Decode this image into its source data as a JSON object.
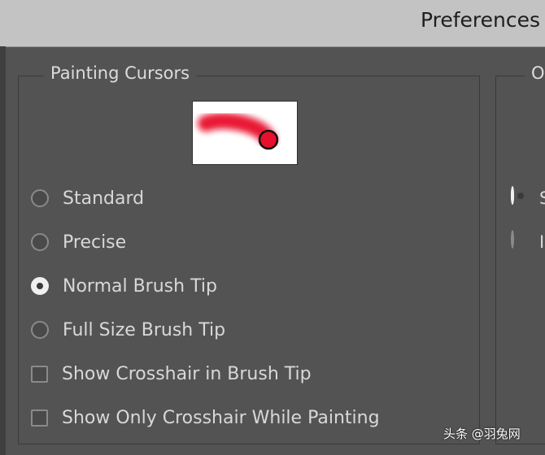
{
  "window": {
    "title": "Preferences"
  },
  "painting_cursors": {
    "legend": "Painting Cursors",
    "options": [
      {
        "label": "Standard",
        "type": "radio",
        "checked": false
      },
      {
        "label": "Precise",
        "type": "radio",
        "checked": false
      },
      {
        "label": "Normal Brush Tip",
        "type": "radio",
        "checked": true
      },
      {
        "label": "Full Size Brush Tip",
        "type": "radio",
        "checked": false
      }
    ],
    "checkboxes": [
      {
        "label": "Show Crosshair in Brush Tip",
        "checked": false
      },
      {
        "label": "Show Only Crosshair While Painting",
        "checked": false
      }
    ],
    "preview": {
      "stroke_color": "#e8102a"
    }
  },
  "other_cursors": {
    "legend": "O",
    "options": [
      {
        "label": "S",
        "type": "radio",
        "checked": true
      },
      {
        "label": "I",
        "type": "radio",
        "checked": false
      }
    ]
  },
  "watermark": "头条 @羽兔网"
}
